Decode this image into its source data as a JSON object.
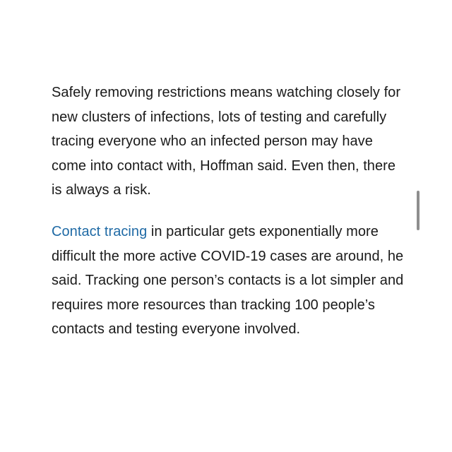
{
  "article": {
    "paragraph_1": "Safely removing restrictions means watching closely for new clusters of infections, lots of testing and carefully tracing everyone who an infected person may have come into contact with, Hoffman said. Even then, there is always a risk.",
    "paragraph_2": {
      "link_text": "Contact tracing",
      "text": " in particular gets exponentially more difficult the more active COVID-19 cases are around, he said. Tracking one person’s contacts is a lot simpler and requires more resources than tracking 100 people’s contacts and testing everyone involved."
    }
  },
  "colors": {
    "text": "#1a1a1a",
    "link": "#1f6aa5",
    "background": "#ffffff",
    "scrollbar": "#8e8e8e"
  }
}
